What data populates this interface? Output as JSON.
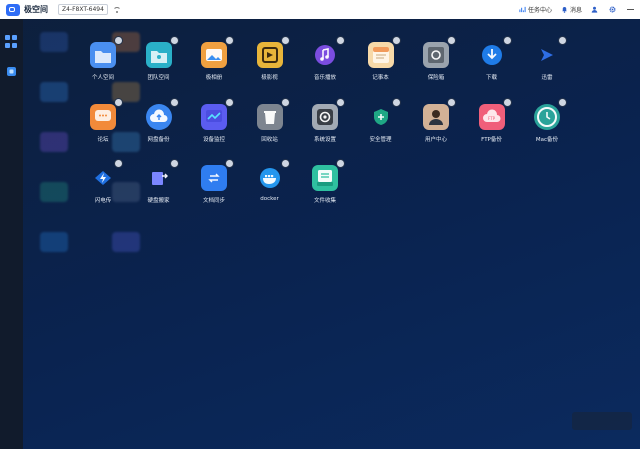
{
  "topbar": {
    "app_name": "极空间",
    "device": "Z4-F8XT-6494",
    "task_center": "任务中心",
    "messages": "消息"
  },
  "sidebar": {
    "items": [
      {
        "icon": "grid-icon",
        "active": true
      },
      {
        "icon": "app-icon",
        "active": false
      }
    ]
  },
  "apps": [
    {
      "label": "个人空间",
      "icon": "folder-icon",
      "color": "#4a8ff0"
    },
    {
      "label": "团队空间",
      "icon": "team-folder-icon",
      "color": "#2ab0c8"
    },
    {
      "label": "极相册",
      "icon": "photo-icon",
      "color": "#f0a040"
    },
    {
      "label": "极影视",
      "icon": "video-icon",
      "color": "#e8b53a"
    },
    {
      "label": "音乐播放",
      "icon": "music-icon",
      "color": "#8a5cf0"
    },
    {
      "label": "记事本",
      "icon": "notepad-icon",
      "color": "#f7d9a8"
    },
    {
      "label": "保险箱",
      "icon": "safe-icon",
      "color": "#9aa3ad"
    },
    {
      "label": "下载",
      "icon": "download-icon",
      "color": "#2a8cf0"
    },
    {
      "label": "迅雷",
      "icon": "thunder-icon",
      "color": "#3a7ff0"
    },
    {
      "label": "论坛",
      "icon": "forum-icon",
      "color": "#f28a3a"
    },
    {
      "label": "网盘备份",
      "icon": "cloud-backup-icon",
      "color": "#3a86f0"
    },
    {
      "label": "设备监控",
      "icon": "monitor-icon",
      "color": "#5b5cf0"
    },
    {
      "label": "回收站",
      "icon": "trash-icon",
      "color": "#7d8590"
    },
    {
      "label": "系统设置",
      "icon": "settings-icon",
      "color": "#a2aab4"
    },
    {
      "label": "安全管理",
      "icon": "shield-icon",
      "color": "#2bbf9a"
    },
    {
      "label": "用户中心",
      "icon": "user-icon",
      "color": "#d2b196"
    },
    {
      "label": "FTP备份",
      "icon": "ftp-icon",
      "color": "#f05f7a"
    },
    {
      "label": "Mac备份",
      "icon": "mac-backup-icon",
      "color": "#2aa39a"
    },
    {
      "label": "闪电传",
      "icon": "flash-transfer-icon",
      "color": "#2a8cf0"
    },
    {
      "label": "硬盘搬家",
      "icon": "disk-move-icon",
      "color": "#5d68f0"
    },
    {
      "label": "文档同步",
      "icon": "sync-icon",
      "color": "#2f7df0"
    },
    {
      "label": "docker",
      "icon": "docker-icon",
      "color": "#2496ed"
    },
    {
      "label": "文件收集",
      "icon": "file-collect-icon",
      "color": "#2fc0a0"
    }
  ],
  "ghost_colors": [
    "#3b6ccf",
    "#f08a3a",
    "#3a8ff0",
    "#e0a040",
    "#8a5cf0",
    "#4aa0e0",
    "#2ab090",
    "#6a7fa0",
    "#2a8cf0",
    "#5d68f0"
  ]
}
